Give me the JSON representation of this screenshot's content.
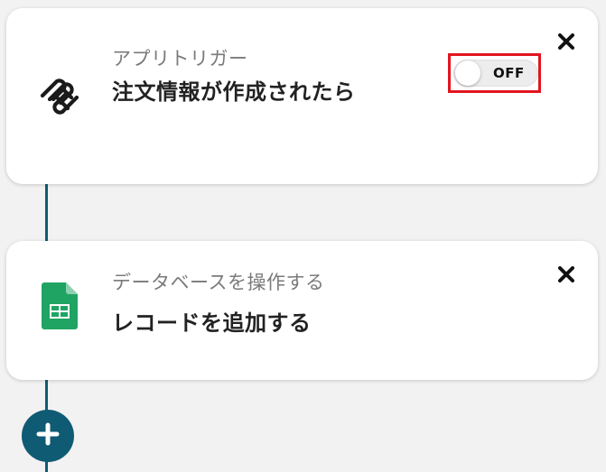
{
  "flow": {
    "trigger": {
      "category": "アプリトリガー",
      "title": "注文情報が作成されたら",
      "app_icon": "squarespace-logo-icon",
      "toggle": {
        "label": "OFF",
        "state": "off"
      },
      "close_icon": "close-icon"
    },
    "action": {
      "category": "データベースを操作する",
      "title": "レコードを追加する",
      "app_icon": "google-sheets-icon",
      "close_icon": "close-icon"
    },
    "add_step_icon": "plus-icon"
  },
  "colors": {
    "connector": "#0f5b73",
    "highlight": "#e2151e",
    "sheets_green": "#1fa463"
  }
}
